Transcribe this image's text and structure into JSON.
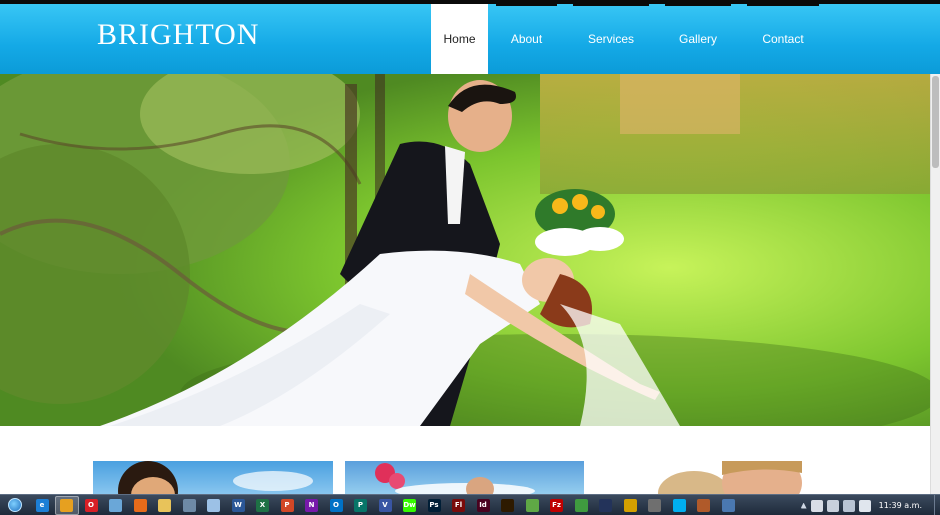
{
  "site": {
    "logo": "BRIGHTON"
  },
  "nav": {
    "items": [
      {
        "label": "Home",
        "active": true
      },
      {
        "label": "About",
        "active": false
      },
      {
        "label": "Services",
        "active": false
      },
      {
        "label": "Gallery",
        "active": false
      },
      {
        "label": "Contact",
        "active": false
      }
    ]
  },
  "hero": {
    "image": "wedding couple dancing on grass"
  },
  "thumbnails": [
    {
      "image": "couple portrait with blue sky"
    },
    {
      "image": "wedding bouquet with sky"
    },
    {
      "image": "smiling couple portrait"
    }
  ],
  "taskbar": {
    "apps": [
      {
        "name": "ie-icon",
        "color": "#1c7fd6",
        "glyph": "e",
        "active": false
      },
      {
        "name": "chrome-icon",
        "color": "#e6a020",
        "glyph": "",
        "active": true
      },
      {
        "name": "opera-icon",
        "color": "#d81f26",
        "glyph": "O",
        "active": false
      },
      {
        "name": "network-icon",
        "color": "#6aa7d8",
        "glyph": "",
        "active": false
      },
      {
        "name": "firefox-icon",
        "color": "#e76b1a",
        "glyph": "",
        "active": false
      },
      {
        "name": "folder-icon",
        "color": "#e8c35a",
        "glyph": "",
        "active": false
      },
      {
        "name": "calculator-icon",
        "color": "#6e8aa6",
        "glyph": "",
        "active": false
      },
      {
        "name": "document-icon",
        "color": "#9cc1e6",
        "glyph": "",
        "active": false
      },
      {
        "name": "word-icon",
        "color": "#2b5797",
        "glyph": "W",
        "active": false
      },
      {
        "name": "excel-icon",
        "color": "#1e7145",
        "glyph": "X",
        "active": false
      },
      {
        "name": "powerpoint-icon",
        "color": "#d24726",
        "glyph": "P",
        "active": false
      },
      {
        "name": "onenote-icon",
        "color": "#7719aa",
        "glyph": "N",
        "active": false
      },
      {
        "name": "outlook-icon",
        "color": "#0072c6",
        "glyph": "O",
        "active": false
      },
      {
        "name": "publisher-icon",
        "color": "#077568",
        "glyph": "P",
        "active": false
      },
      {
        "name": "visio-icon",
        "color": "#3955a3",
        "glyph": "V",
        "active": false
      },
      {
        "name": "dreamweaver-icon",
        "color": "#35fa00",
        "glyph": "Dw",
        "active": false
      },
      {
        "name": "photoshop-icon",
        "color": "#001e36",
        "glyph": "Ps",
        "active": false
      },
      {
        "name": "flash-icon",
        "color": "#7a0b0b",
        "glyph": "Fl",
        "active": false
      },
      {
        "name": "indesign-icon",
        "color": "#49021f",
        "glyph": "Id",
        "active": false
      },
      {
        "name": "illustrator-icon",
        "color": "#2e1a00",
        "glyph": "",
        "active": false
      },
      {
        "name": "notepad-plus-icon",
        "color": "#5fa845",
        "glyph": "",
        "active": false
      },
      {
        "name": "filezilla-icon",
        "color": "#bf0000",
        "glyph": "Fz",
        "active": false
      },
      {
        "name": "app-green-icon",
        "color": "#3f9b3f",
        "glyph": "",
        "active": false
      },
      {
        "name": "eye-icon",
        "color": "#23335a",
        "glyph": "",
        "active": false
      },
      {
        "name": "circle-app-icon",
        "color": "#d4a000",
        "glyph": "",
        "active": false
      },
      {
        "name": "settings-icon",
        "color": "#6f6f6f",
        "glyph": "",
        "active": false
      },
      {
        "name": "skype-icon",
        "color": "#00aff0",
        "glyph": "",
        "active": false
      },
      {
        "name": "photo-icon",
        "color": "#b05a2a",
        "glyph": "",
        "active": false
      },
      {
        "name": "image-viewer-icon",
        "color": "#4a78b0",
        "glyph": "",
        "active": false
      }
    ],
    "clock": "11:39 a.m."
  }
}
